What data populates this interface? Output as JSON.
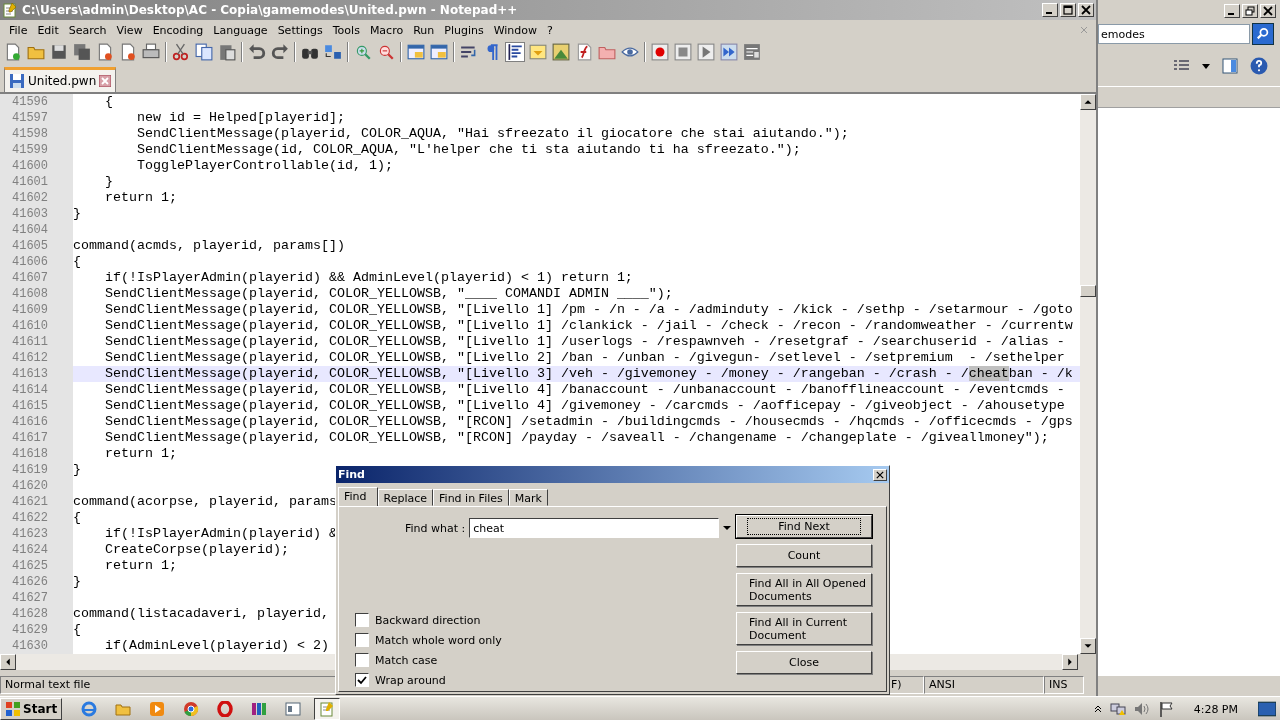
{
  "window": {
    "title": "C:\\Users\\admin\\Desktop\\AC - Copia\\gamemodes\\United.pwn - Notepad++"
  },
  "menu": [
    "File",
    "Edit",
    "Search",
    "View",
    "Encoding",
    "Language",
    "Settings",
    "Tools",
    "Macro",
    "Run",
    "Plugins",
    "Window",
    "?"
  ],
  "tabs": [
    {
      "label": "United.pwn",
      "selected": true
    }
  ],
  "editor": {
    "lines": [
      {
        "number": "41596",
        "text": "    {",
        "current": false
      },
      {
        "number": "41597",
        "text": "        new id = Helped[playerid];",
        "current": false
      },
      {
        "number": "41598",
        "text": "        SendClientMessage(playerid, COLOR_AQUA, \"Hai sfreezato il giocatore che stai aiutando.\");",
        "current": false
      },
      {
        "number": "41599",
        "text": "        SendClientMessage(id, COLOR_AQUA, \"L'helper che ti sta aiutando ti ha sfreezato.\");",
        "current": false
      },
      {
        "number": "41600",
        "text": "        TogglePlayerControllable(id, 1);",
        "current": false
      },
      {
        "number": "41601",
        "text": "    }",
        "current": false
      },
      {
        "number": "41602",
        "text": "    return 1;",
        "current": false
      },
      {
        "number": "41603",
        "text": "}",
        "current": false
      },
      {
        "number": "41604",
        "current": false
      },
      {
        "number": "41605",
        "text": "command(acmds, playerid, params[])",
        "current": false
      },
      {
        "number": "41606",
        "text": "{",
        "current": false
      },
      {
        "number": "41607",
        "text": "    if(!IsPlayerAdmin(playerid) && AdminLevel(playerid) < 1) return 1;",
        "current": false
      },
      {
        "number": "41608",
        "text": "    SendClientMessage(playerid, COLOR_YELLOWSB, \"____ COMANDI ADMIN ____\");",
        "current": false
      },
      {
        "number": "41609",
        "text": "    SendClientMessage(playerid, COLOR_YELLOWSB, \"[Livello 1] /pm - /n - /a - /adminduty - /kick - /sethp - /setarmour - /goto",
        "current": false
      },
      {
        "number": "41610",
        "text": "    SendClientMessage(playerid, COLOR_YELLOWSB, \"[Livello 1] /clankick - /jail - /check - /recon - /randomweather - /currentw",
        "current": false
      },
      {
        "number": "41611",
        "text": "    SendClientMessage(playerid, COLOR_YELLOWSB, \"[Livello 1] /userlogs - /respawnveh - /resetgraf - /searchuserid - /alias -",
        "current": false
      },
      {
        "number": "41612",
        "text": "    SendClientMessage(playerid, COLOR_YELLOWSB, \"[Livello 2] /ban - /unban - /givegun- /setlevel - /setpremium  - /sethelper",
        "current": false
      },
      {
        "number": "41613",
        "parts": [
          {
            "kind": "plain",
            "text": "    SendClientMessage(playerid, COLOR_YELLOWSB, \"[Livello 3] /veh - /givemoney - /money - /rangeban - /crash - /"
          },
          {
            "kind": "match",
            "text": "cheat"
          },
          {
            "kind": "plain",
            "text": "ban - /k"
          }
        ],
        "current": true
      },
      {
        "number": "41614",
        "text": "    SendClientMessage(playerid, COLOR_YELLOWSB, \"[Livello 4] /banaccount - /unbanaccount - /banofflineaccount - /eventcmds -",
        "current": false
      },
      {
        "number": "41615",
        "text": "    SendClientMessage(playerid, COLOR_YELLOWSB, \"[Livello 4] /givemoney - /carcmds - /aofficepay - /giveobject - /ahousetype",
        "current": false
      },
      {
        "number": "41616",
        "text": "    SendClientMessage(playerid, COLOR_YELLOWSB, \"[RCON] /setadmin - /buildingcmds - /housecmds - /hqcmds - /officecmds - /gps",
        "current": false
      },
      {
        "number": "41617",
        "text": "    SendClientMessage(playerid, COLOR_YELLOWSB, \"[RCON] /payday - /saveall - /changename - /changeplate - /giveallmoney\");",
        "current": false
      },
      {
        "number": "41618",
        "text": "    return 1;",
        "current": false
      },
      {
        "number": "41619",
        "text": "}",
        "current": false
      },
      {
        "number": "41620",
        "current": false
      },
      {
        "number": "41621",
        "text": "command(acorpse, playerid, params",
        "current": false
      },
      {
        "number": "41622",
        "text": "{",
        "current": false
      },
      {
        "number": "41623",
        "text": "    if(!IsPlayerAdmin(playerid) &",
        "current": false
      },
      {
        "number": "41624",
        "text": "    CreateCorpse(playerid);",
        "current": false
      },
      {
        "number": "41625",
        "text": "    return 1;",
        "current": false
      },
      {
        "number": "41626",
        "text": "}",
        "current": false
      },
      {
        "number": "41627",
        "current": false
      },
      {
        "number": "41628",
        "text": "command(listacadaveri, playerid,",
        "current": false
      },
      {
        "number": "41629",
        "text": "{",
        "current": false
      },
      {
        "number": "41630",
        "text": "    if(AdminLevel(playerid) < 2)",
        "current": false
      }
    ]
  },
  "status_bar": {
    "file_type": "Normal text file",
    "line_ending": "F)",
    "encoding": "ANSI",
    "mode": "INS"
  },
  "find_dialog": {
    "title": "Find",
    "tabs": [
      {
        "label": "Find",
        "selected": true
      },
      {
        "label": "Replace",
        "selected": false
      },
      {
        "label": "Find in Files",
        "selected": false
      },
      {
        "label": "Mark",
        "selected": false
      }
    ],
    "find_what": {
      "label": "Find what :",
      "value": "cheat"
    },
    "buttons": [
      {
        "label": "Find Next",
        "focused": true
      },
      {
        "label": "Count",
        "focused": false
      },
      {
        "label": "Find All in All Opened Documents",
        "focused": false
      },
      {
        "label": "Find All in Current Document",
        "focused": false
      },
      {
        "label": "Close",
        "focused": false
      }
    ],
    "options": [
      {
        "label": "Backward direction",
        "checked": false
      },
      {
        "label": "Match whole word only",
        "checked": false
      },
      {
        "label": "Match case",
        "checked": false
      },
      {
        "label": "Wrap around",
        "checked": true
      }
    ]
  },
  "explorer": {
    "search_value": "emodes"
  },
  "taskbar": {
    "start": "Start",
    "clock": "4:28 PM"
  }
}
